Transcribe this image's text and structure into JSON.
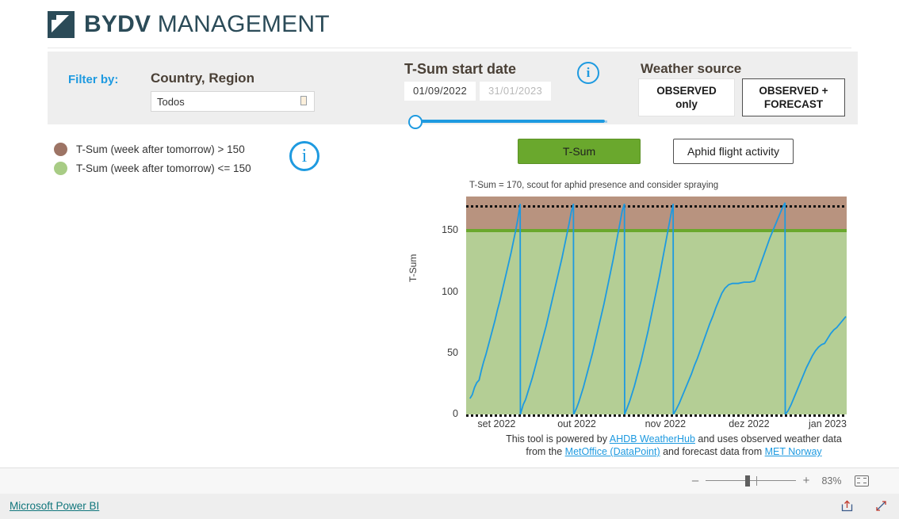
{
  "header": {
    "logo_bold": "BYDV",
    "logo_light": "MANAGEMENT",
    "logo_icon": "bydv-leaf-icon"
  },
  "filter_bar": {
    "filter_by_label": "Filter by:",
    "country_region_label": "Country, Region",
    "country_select_value": "Todos",
    "country_select_placeholder": "Todos",
    "tsum_start_date_label": "T-Sum start date",
    "tsum_info_icon": "info-icon",
    "date_from": "01/09/2022",
    "date_to": "31/01/2023",
    "weather_source_label": "Weather source",
    "weather_observed_line1": "OBSERVED",
    "weather_observed_line2": "only",
    "weather_forecast_line1": "OBSERVED +",
    "weather_forecast_line2": "FORECAST",
    "selected_weather_source": "OBSERVED + FORECAST"
  },
  "legend": {
    "items": [
      {
        "color": "#9d7465",
        "label": "T-Sum (week after tomorrow) > 150"
      },
      {
        "color": "#a8cc85",
        "label": "T-Sum (week after tomorrow) <= 150"
      }
    ],
    "info_icon": "info-icon"
  },
  "tabs": {
    "items": [
      {
        "label": "T-Sum",
        "selected": true
      },
      {
        "label": "Aphid flight activity",
        "selected": false
      }
    ]
  },
  "chart_data": {
    "type": "line",
    "title": "",
    "annotation": "T-Sum = 170, scout for aphid presence and consider spraying",
    "xlabel": "",
    "ylabel": "T-Sum",
    "ylim": [
      0,
      178
    ],
    "yticks": [
      0,
      50,
      100,
      150
    ],
    "xticks": [
      "set 2022",
      "out 2022",
      "nov 2022",
      "dez 2022",
      "jan 2023"
    ],
    "xtick_positions": [
      0.03,
      0.24,
      0.47,
      0.69,
      0.9
    ],
    "grid": false,
    "legend_position": "top-left-external",
    "line_color": "#1e9ae0",
    "bands": [
      {
        "name": "T-Sum (week after tomorrow) > 150",
        "from": 150,
        "to": 178,
        "color": "#b8937f"
      },
      {
        "name": "T-Sum (week after tomorrow) <= 150",
        "from": 0,
        "to": 150,
        "color": "#b4ce95"
      }
    ],
    "threshold_line": {
      "value": 150,
      "color": "#6aa82d"
    },
    "top_dotted_line": {
      "value": 170,
      "color": "#111111"
    },
    "series": [
      {
        "name": "Cumulative T-Sum",
        "comment": "sawtooth: accumulates then resets to 0 at each new start date cohort",
        "points": [
          [
            0.01,
            13
          ],
          [
            0.016,
            16
          ],
          [
            0.022,
            22
          ],
          [
            0.028,
            26
          ],
          [
            0.034,
            28
          ],
          [
            0.04,
            36
          ],
          [
            0.046,
            43
          ],
          [
            0.052,
            49
          ],
          [
            0.058,
            56
          ],
          [
            0.064,
            63
          ],
          [
            0.07,
            70
          ],
          [
            0.076,
            77
          ],
          [
            0.082,
            85
          ],
          [
            0.088,
            92
          ],
          [
            0.094,
            100
          ],
          [
            0.1,
            108
          ],
          [
            0.106,
            116
          ],
          [
            0.112,
            124
          ],
          [
            0.118,
            132
          ],
          [
            0.124,
            141
          ],
          [
            0.13,
            150
          ],
          [
            0.136,
            160
          ],
          [
            0.142,
            172
          ],
          [
            0.1425,
            0
          ],
          [
            0.15,
            8
          ],
          [
            0.156,
            12
          ],
          [
            0.162,
            18
          ],
          [
            0.168,
            24
          ],
          [
            0.174,
            30
          ],
          [
            0.18,
            37
          ],
          [
            0.186,
            44
          ],
          [
            0.192,
            51
          ],
          [
            0.198,
            58
          ],
          [
            0.204,
            65
          ],
          [
            0.21,
            72
          ],
          [
            0.216,
            80
          ],
          [
            0.222,
            88
          ],
          [
            0.228,
            96
          ],
          [
            0.234,
            104
          ],
          [
            0.24,
            112
          ],
          [
            0.246,
            120
          ],
          [
            0.252,
            128
          ],
          [
            0.258,
            137
          ],
          [
            0.264,
            146
          ],
          [
            0.27,
            155
          ],
          [
            0.276,
            165
          ],
          [
            0.282,
            172
          ],
          [
            0.2825,
            0
          ],
          [
            0.29,
            5
          ],
          [
            0.296,
            10
          ],
          [
            0.302,
            16
          ],
          [
            0.308,
            22
          ],
          [
            0.314,
            29
          ],
          [
            0.32,
            36
          ],
          [
            0.326,
            43
          ],
          [
            0.332,
            50
          ],
          [
            0.338,
            58
          ],
          [
            0.344,
            66
          ],
          [
            0.35,
            74
          ],
          [
            0.356,
            82
          ],
          [
            0.362,
            90
          ],
          [
            0.368,
            99
          ],
          [
            0.374,
            108
          ],
          [
            0.38,
            117
          ],
          [
            0.386,
            126
          ],
          [
            0.392,
            136
          ],
          [
            0.398,
            146
          ],
          [
            0.404,
            156
          ],
          [
            0.41,
            166
          ],
          [
            0.416,
            172
          ],
          [
            0.4165,
            0
          ],
          [
            0.424,
            6
          ],
          [
            0.43,
            11
          ],
          [
            0.436,
            17
          ],
          [
            0.442,
            23
          ],
          [
            0.448,
            30
          ],
          [
            0.454,
            37
          ],
          [
            0.46,
            44
          ],
          [
            0.466,
            52
          ],
          [
            0.472,
            60
          ],
          [
            0.478,
            68
          ],
          [
            0.484,
            77
          ],
          [
            0.49,
            86
          ],
          [
            0.496,
            95
          ],
          [
            0.502,
            104
          ],
          [
            0.508,
            113
          ],
          [
            0.514,
            123
          ],
          [
            0.52,
            133
          ],
          [
            0.526,
            143
          ],
          [
            0.532,
            153
          ],
          [
            0.538,
            163
          ],
          [
            0.544,
            172
          ],
          [
            0.5445,
            0
          ],
          [
            0.552,
            4
          ],
          [
            0.56,
            9
          ],
          [
            0.568,
            15
          ],
          [
            0.576,
            21
          ],
          [
            0.584,
            27
          ],
          [
            0.592,
            33
          ],
          [
            0.6,
            40
          ],
          [
            0.608,
            46
          ],
          [
            0.616,
            53
          ],
          [
            0.624,
            60
          ],
          [
            0.632,
            67
          ],
          [
            0.64,
            74
          ],
          [
            0.648,
            80
          ],
          [
            0.656,
            87
          ],
          [
            0.664,
            93
          ],
          [
            0.672,
            99
          ],
          [
            0.68,
            103
          ],
          [
            0.69,
            106
          ],
          [
            0.7,
            107
          ],
          [
            0.715,
            107
          ],
          [
            0.73,
            108
          ],
          [
            0.745,
            108
          ],
          [
            0.758,
            109
          ],
          [
            0.766,
            116
          ],
          [
            0.774,
            123
          ],
          [
            0.782,
            130
          ],
          [
            0.79,
            137
          ],
          [
            0.798,
            144
          ],
          [
            0.806,
            150
          ],
          [
            0.814,
            156
          ],
          [
            0.822,
            162
          ],
          [
            0.83,
            168
          ],
          [
            0.838,
            173
          ],
          [
            0.8385,
            0
          ],
          [
            0.846,
            3
          ],
          [
            0.854,
            8
          ],
          [
            0.862,
            14
          ],
          [
            0.87,
            20
          ],
          [
            0.878,
            26
          ],
          [
            0.886,
            32
          ],
          [
            0.894,
            38
          ],
          [
            0.902,
            43
          ],
          [
            0.91,
            48
          ],
          [
            0.918,
            52
          ],
          [
            0.926,
            55
          ],
          [
            0.934,
            57
          ],
          [
            0.942,
            58
          ],
          [
            0.95,
            62
          ],
          [
            0.958,
            66
          ],
          [
            0.966,
            69
          ],
          [
            0.974,
            71
          ],
          [
            0.982,
            74
          ],
          [
            0.99,
            77
          ],
          [
            0.998,
            80
          ]
        ]
      }
    ]
  },
  "footer_note": {
    "text_1": "This tool is powered by ",
    "link_1": "AHDB WeatherHub",
    "text_2": " and uses observed weather data from the ",
    "link_2": "MetOffice (DataPoint)",
    "text_3": " and forecast data from ",
    "link_3": "MET Norway"
  },
  "status_bar": {
    "zoom_minus": "–",
    "zoom_plus": "+",
    "zoom_percent": "83%",
    "fit_icon": "fit-to-page-icon"
  },
  "bottom_bar": {
    "powerbi_link": "Microsoft Power BI",
    "share_icon": "share-icon",
    "fullscreen_icon": "fullscreen-icon"
  }
}
